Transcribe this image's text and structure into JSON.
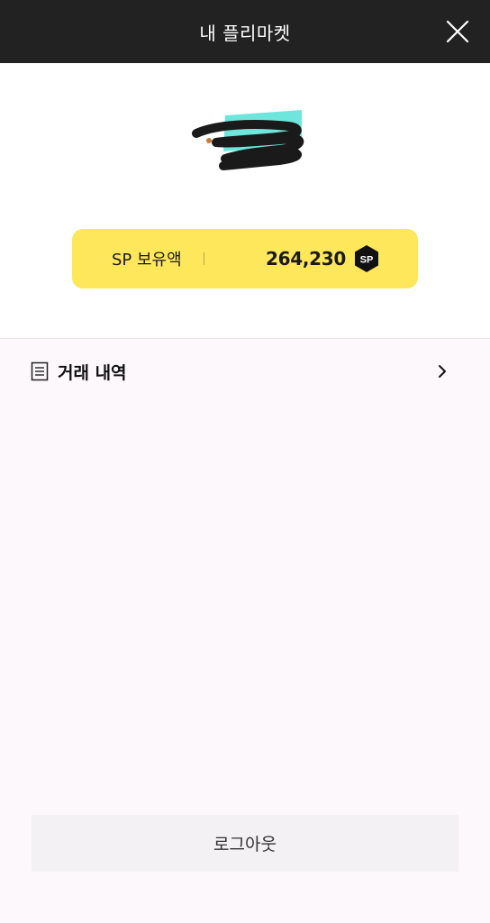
{
  "header": {
    "title": "내 플리마켓",
    "close_icon": "close-icon"
  },
  "wallet": {
    "label": "SP 보유액",
    "amount": "264,230",
    "badge_text": "SP",
    "card_color": "#fee75a"
  },
  "menu": {
    "history_label": "거래 내역",
    "history_icon": "document-icon",
    "arrow_icon": "chevron-right-icon"
  },
  "footer": {
    "logout_label": "로그아웃"
  }
}
